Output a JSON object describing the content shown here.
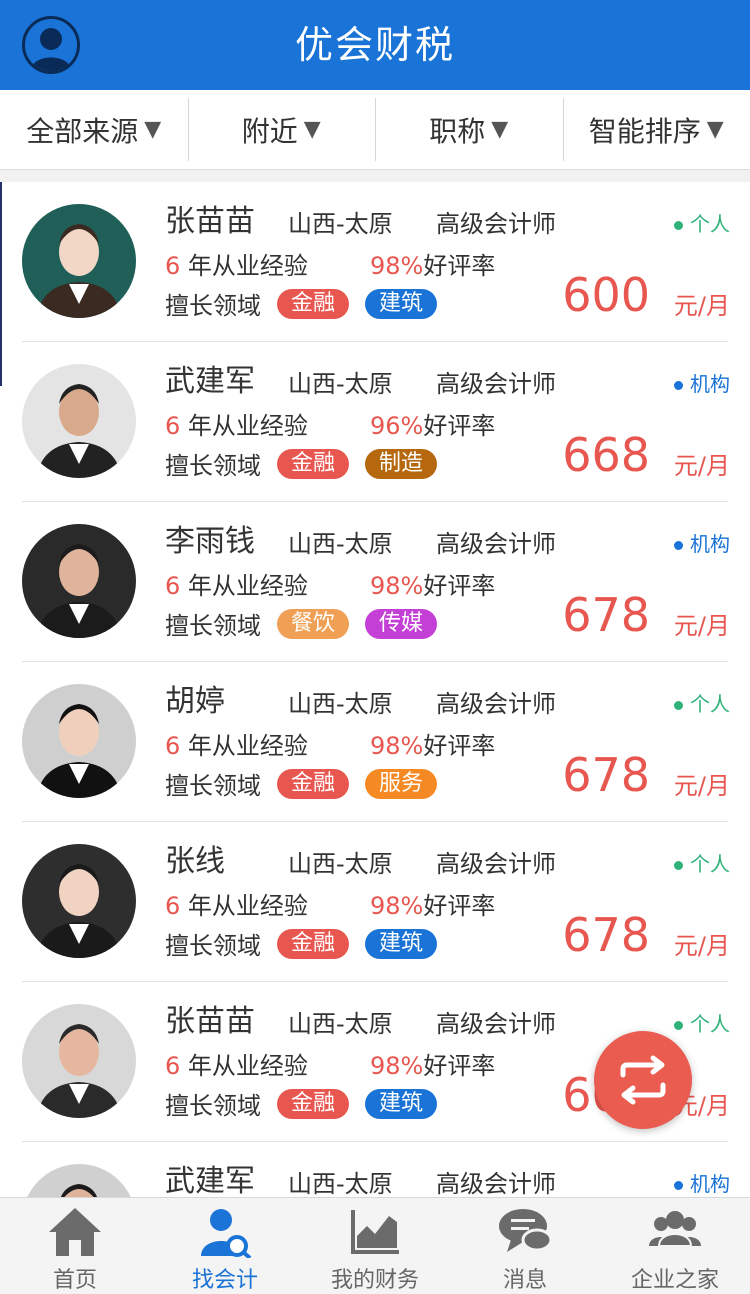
{
  "header": {
    "title": "优会财税",
    "avatar_icon": "user-avatar-icon"
  },
  "filters": [
    {
      "label": "全部来源",
      "arrow": "▼"
    },
    {
      "label": "附近",
      "arrow": "▼"
    },
    {
      "label": "职称",
      "arrow": "▼"
    },
    {
      "label": "智能排序",
      "arrow": "▼"
    }
  ],
  "accountants": [
    {
      "name": "张苗苗",
      "location": "山西-太原",
      "title": "高级会计师",
      "type": "个人",
      "years": "6",
      "exp_suffix": "年从业经验",
      "rating": "98%",
      "rating_suffix": "好评率",
      "skills_label": "擅长领域",
      "tags": [
        {
          "text": "金融",
          "color": "#e8574f"
        },
        {
          "text": "建筑",
          "color": "#1a73d6"
        }
      ],
      "price": "600",
      "unit": "元/月"
    },
    {
      "name": "武建军",
      "location": "山西-太原",
      "title": "高级会计师",
      "type": "机构",
      "years": "6",
      "exp_suffix": "年从业经验",
      "rating": "96%",
      "rating_suffix": "好评率",
      "skills_label": "擅长领域",
      "tags": [
        {
          "text": "金融",
          "color": "#e8574f"
        },
        {
          "text": "制造",
          "color": "#b5680e"
        }
      ],
      "price": "668",
      "unit": "元/月"
    },
    {
      "name": "李雨钱",
      "location": "山西-太原",
      "title": "高级会计师",
      "type": "机构",
      "years": "6",
      "exp_suffix": "年从业经验",
      "rating": "98%",
      "rating_suffix": "好评率",
      "skills_label": "擅长领域",
      "tags": [
        {
          "text": "餐饮",
          "color": "#f0a055"
        },
        {
          "text": "传媒",
          "color": "#c43fd6"
        }
      ],
      "price": "678",
      "unit": "元/月"
    },
    {
      "name": "胡婷",
      "location": "山西-太原",
      "title": "高级会计师",
      "type": "个人",
      "years": "6",
      "exp_suffix": "年从业经验",
      "rating": "98%",
      "rating_suffix": "好评率",
      "skills_label": "擅长领域",
      "tags": [
        {
          "text": "金融",
          "color": "#e8574f"
        },
        {
          "text": "服务",
          "color": "#f58a25"
        }
      ],
      "price": "678",
      "unit": "元/月"
    },
    {
      "name": "张线",
      "location": "山西-太原",
      "title": "高级会计师",
      "type": "个人",
      "years": "6",
      "exp_suffix": "年从业经验",
      "rating": "98%",
      "rating_suffix": "好评率",
      "skills_label": "擅长领域",
      "tags": [
        {
          "text": "金融",
          "color": "#e8574f"
        },
        {
          "text": "建筑",
          "color": "#1a73d6"
        }
      ],
      "price": "678",
      "unit": "元/月"
    },
    {
      "name": "张苗苗",
      "location": "山西-太原",
      "title": "高级会计师",
      "type": "个人",
      "years": "6",
      "exp_suffix": "年从业经验",
      "rating": "98%",
      "rating_suffix": "好评率",
      "skills_label": "擅长领域",
      "tags": [
        {
          "text": "金融",
          "color": "#e8574f"
        },
        {
          "text": "建筑",
          "color": "#1a73d6"
        }
      ],
      "price": "600",
      "unit": "元/月"
    },
    {
      "name": "武建军",
      "location": "山西-太原",
      "title": "高级会计师",
      "type": "机构",
      "years": "",
      "exp_suffix": "",
      "rating": "",
      "rating_suffix": "",
      "skills_label": "",
      "tags": [],
      "price": "",
      "unit": ""
    }
  ],
  "type_colors": {
    "个人": "#2fb27a",
    "机构": "#1a73d6"
  },
  "fab": {
    "icon": "switch-arrows-icon"
  },
  "tabbar": [
    {
      "label": "首页",
      "icon": "home-icon",
      "active": false
    },
    {
      "label": "找会计",
      "icon": "find-accountant-icon",
      "active": true
    },
    {
      "label": "我的财务",
      "icon": "chart-icon",
      "active": false
    },
    {
      "label": "消息",
      "icon": "message-icon",
      "active": false
    },
    {
      "label": "企业之家",
      "icon": "group-icon",
      "active": false
    }
  ]
}
